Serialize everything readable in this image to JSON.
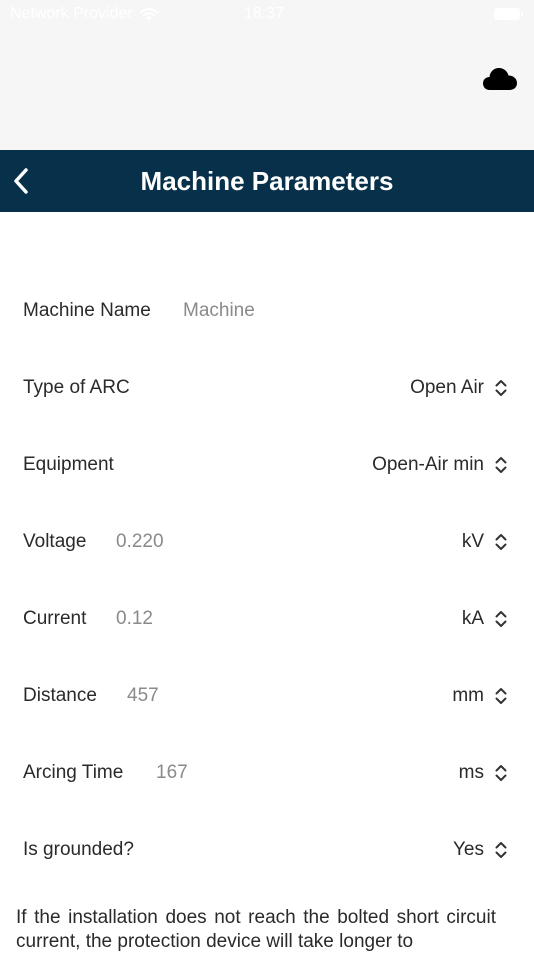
{
  "status_bar": {
    "carrier": "Network Provider",
    "time": "18:37",
    "icons": [
      "wifi-icon",
      "battery-icon"
    ]
  },
  "header": {
    "cloud_icon": "cloud-icon",
    "back_icon": "chevron-left-icon",
    "title": "Machine Parameters",
    "color": "#07304a"
  },
  "form": {
    "machine_name": {
      "label": "Machine Name",
      "placeholder": "Machine"
    },
    "type_of_arc": {
      "label": "Type of ARC",
      "selected": "Open Air"
    },
    "equipment": {
      "label": "Equipment",
      "selected": "Open-Air min"
    },
    "voltage": {
      "label": "Voltage",
      "value": "0.220",
      "unit": "kV"
    },
    "current": {
      "label": "Current",
      "value": "0.12",
      "unit": "kA"
    },
    "distance": {
      "label": "Distance",
      "value": "457",
      "unit": "mm"
    },
    "arcing_time": {
      "label": "Arcing Time",
      "value": "167",
      "unit": "ms"
    },
    "is_grounded": {
      "label": "Is grounded?",
      "selected": "Yes"
    }
  },
  "footnote": "If the installation does not reach the bolted short circuit current, the protection device will take longer to"
}
